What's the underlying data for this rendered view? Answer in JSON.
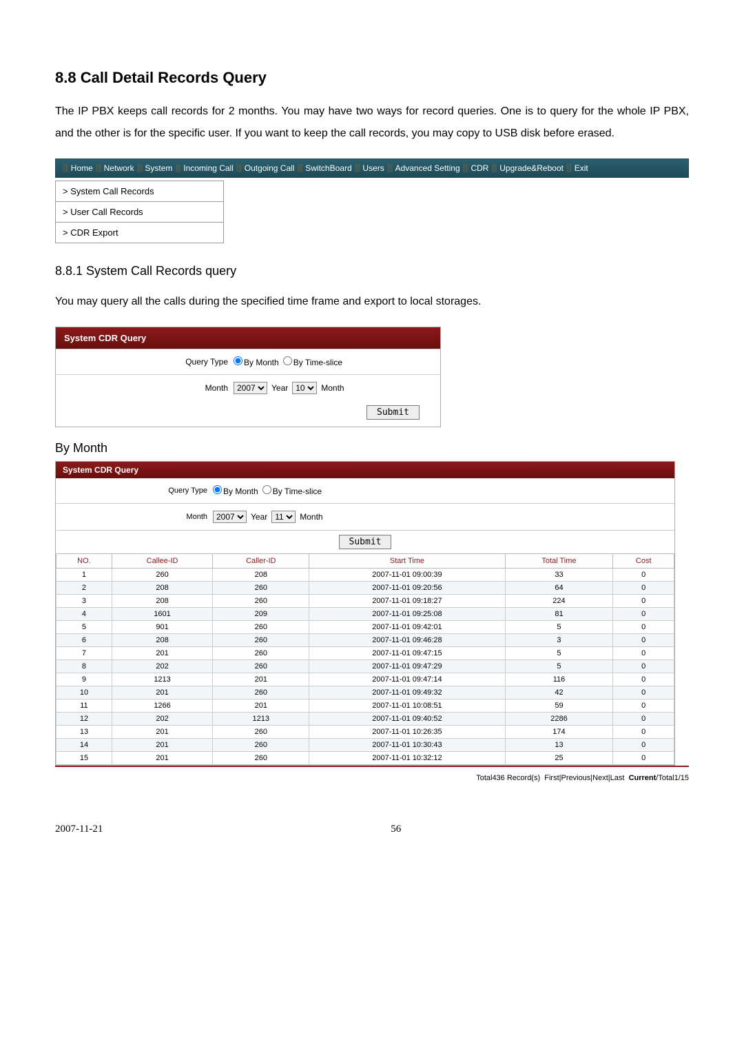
{
  "heading": "8.8 Call Detail Records Query",
  "intro": "The IP PBX keeps call records for 2 months.    You may have two ways for record queries.    One is to query for the whole IP PBX, and the other is for the specific user.    If you want to keep the call records, you may copy to USB disk before erased.",
  "nav": [
    "Home",
    "Network",
    "System",
    "Incoming Call",
    "Outgoing Call",
    "SwitchBoard",
    "Users",
    "Advanced Setting",
    "CDR",
    "Upgrade&Reboot",
    "Exit"
  ],
  "side": [
    ">  System Call Records",
    ">  User Call Records",
    ">  CDR Export"
  ],
  "sub_heading": "8.8.1 System Call Records query",
  "sub_text": "You may query all the calls during the specified time frame and export to local storages.",
  "panel1": {
    "title": "System CDR Query",
    "query_type_label": "Query Type",
    "by_month": "By Month",
    "by_timeslice": "By Time-slice",
    "month_label": "Month",
    "year_value": "2007",
    "year_suffix": "Year",
    "month_value": "10",
    "month_suffix": "Month",
    "submit": "Submit"
  },
  "by_month_heading": "By Month",
  "panel2": {
    "title": "System CDR Query",
    "query_type_label": "Query Type",
    "by_month": "By Month",
    "by_timeslice": "By Time-slice",
    "month_label": "Month",
    "year_value": "2007",
    "year_suffix": "Year",
    "month_value": "11",
    "month_suffix": "Month",
    "submit": "Submit"
  },
  "table": {
    "headers": [
      "NO.",
      "Callee-ID",
      "Caller-ID",
      "Start Time",
      "Total Time",
      "Cost"
    ],
    "rows": [
      [
        "1",
        "260",
        "208",
        "2007-11-01 09:00:39",
        "33",
        "0"
      ],
      [
        "2",
        "208",
        "260",
        "2007-11-01 09:20:56",
        "64",
        "0"
      ],
      [
        "3",
        "208",
        "260",
        "2007-11-01 09:18:27",
        "224",
        "0"
      ],
      [
        "4",
        "1601",
        "209",
        "2007-11-01 09:25:08",
        "81",
        "0"
      ],
      [
        "5",
        "901",
        "260",
        "2007-11-01 09:42:01",
        "5",
        "0"
      ],
      [
        "6",
        "208",
        "260",
        "2007-11-01 09:46:28",
        "3",
        "0"
      ],
      [
        "7",
        "201",
        "260",
        "2007-11-01 09:47:15",
        "5",
        "0"
      ],
      [
        "8",
        "202",
        "260",
        "2007-11-01 09:47:29",
        "5",
        "0"
      ],
      [
        "9",
        "1213",
        "201",
        "2007-11-01 09:47:14",
        "116",
        "0"
      ],
      [
        "10",
        "201",
        "260",
        "2007-11-01 09:49:32",
        "42",
        "0"
      ],
      [
        "11",
        "1266",
        "201",
        "2007-11-01 10:08:51",
        "59",
        "0"
      ],
      [
        "12",
        "202",
        "1213",
        "2007-11-01 09:40:52",
        "2286",
        "0"
      ],
      [
        "13",
        "201",
        "260",
        "2007-11-01 10:26:35",
        "174",
        "0"
      ],
      [
        "14",
        "201",
        "260",
        "2007-11-01 10:30:43",
        "13",
        "0"
      ],
      [
        "15",
        "201",
        "260",
        "2007-11-01 10:32:12",
        "25",
        "0"
      ]
    ]
  },
  "pager": {
    "total_text": "Total436 Record(s)",
    "links": "First|Previous|Next|Last",
    "current_label": "Current",
    "tail": "/Total1/15"
  },
  "footer": {
    "date": "2007-11-21",
    "page": "56"
  }
}
